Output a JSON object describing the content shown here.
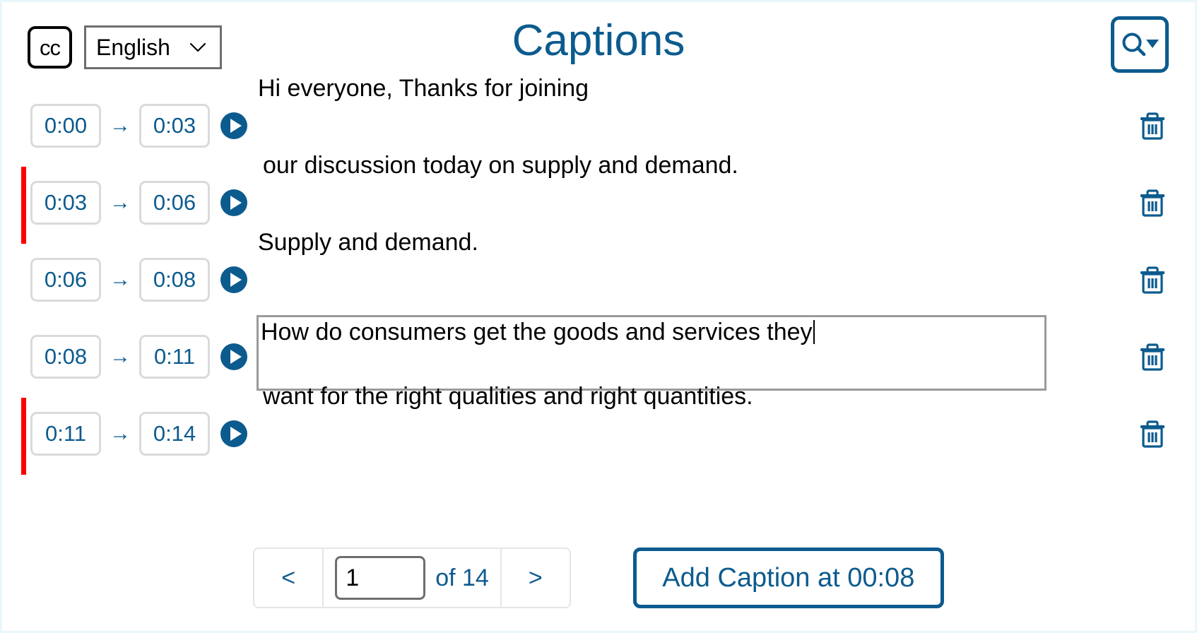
{
  "colors": {
    "accent_blue": "#0c5b8e",
    "error_red": "#fb0000",
    "border_gray": "#d8dadc",
    "focus_border": "#9a9a9a",
    "page_edge": "#e9f6fb"
  },
  "header": {
    "cc_label": "cc",
    "cc_icon": "closed-caption-icon",
    "language": "English",
    "language_chevron_icon": "chevron-down-icon",
    "title": "Captions",
    "search_icon": "search-icon",
    "search_dropdown_icon": "caret-down-icon"
  },
  "captions": [
    {
      "start": "0:00",
      "end": "0:03",
      "arrow": "→",
      "text": "Hi everyone, Thanks for joining",
      "flagged": false,
      "editing": false,
      "play_icon": "play-icon",
      "delete_icon": "trash-icon"
    },
    {
      "start": "0:03",
      "end": "0:06",
      "arrow": "→",
      "text": "our discussion today on supply and demand.",
      "flagged": true,
      "editing": false,
      "play_icon": "play-icon",
      "delete_icon": "trash-icon"
    },
    {
      "start": "0:06",
      "end": "0:08",
      "arrow": "→",
      "text": "Supply and demand.",
      "flagged": false,
      "editing": false,
      "play_icon": "play-icon",
      "delete_icon": "trash-icon"
    },
    {
      "start": "0:08",
      "end": "0:11",
      "arrow": "→",
      "text": "How do consumers get the goods and services they",
      "flagged": false,
      "editing": true,
      "play_icon": "play-icon",
      "delete_icon": "trash-icon"
    },
    {
      "start": "0:11",
      "end": "0:14",
      "arrow": "→",
      "text": "want for the right qualities and right quantities.",
      "flagged": true,
      "editing": false,
      "play_icon": "play-icon",
      "delete_icon": "trash-icon"
    }
  ],
  "footer": {
    "prev_label": "<",
    "next_label": ">",
    "page_value": "1",
    "page_total_label": "of 14",
    "add_caption_label": "Add Caption at 00:08"
  }
}
